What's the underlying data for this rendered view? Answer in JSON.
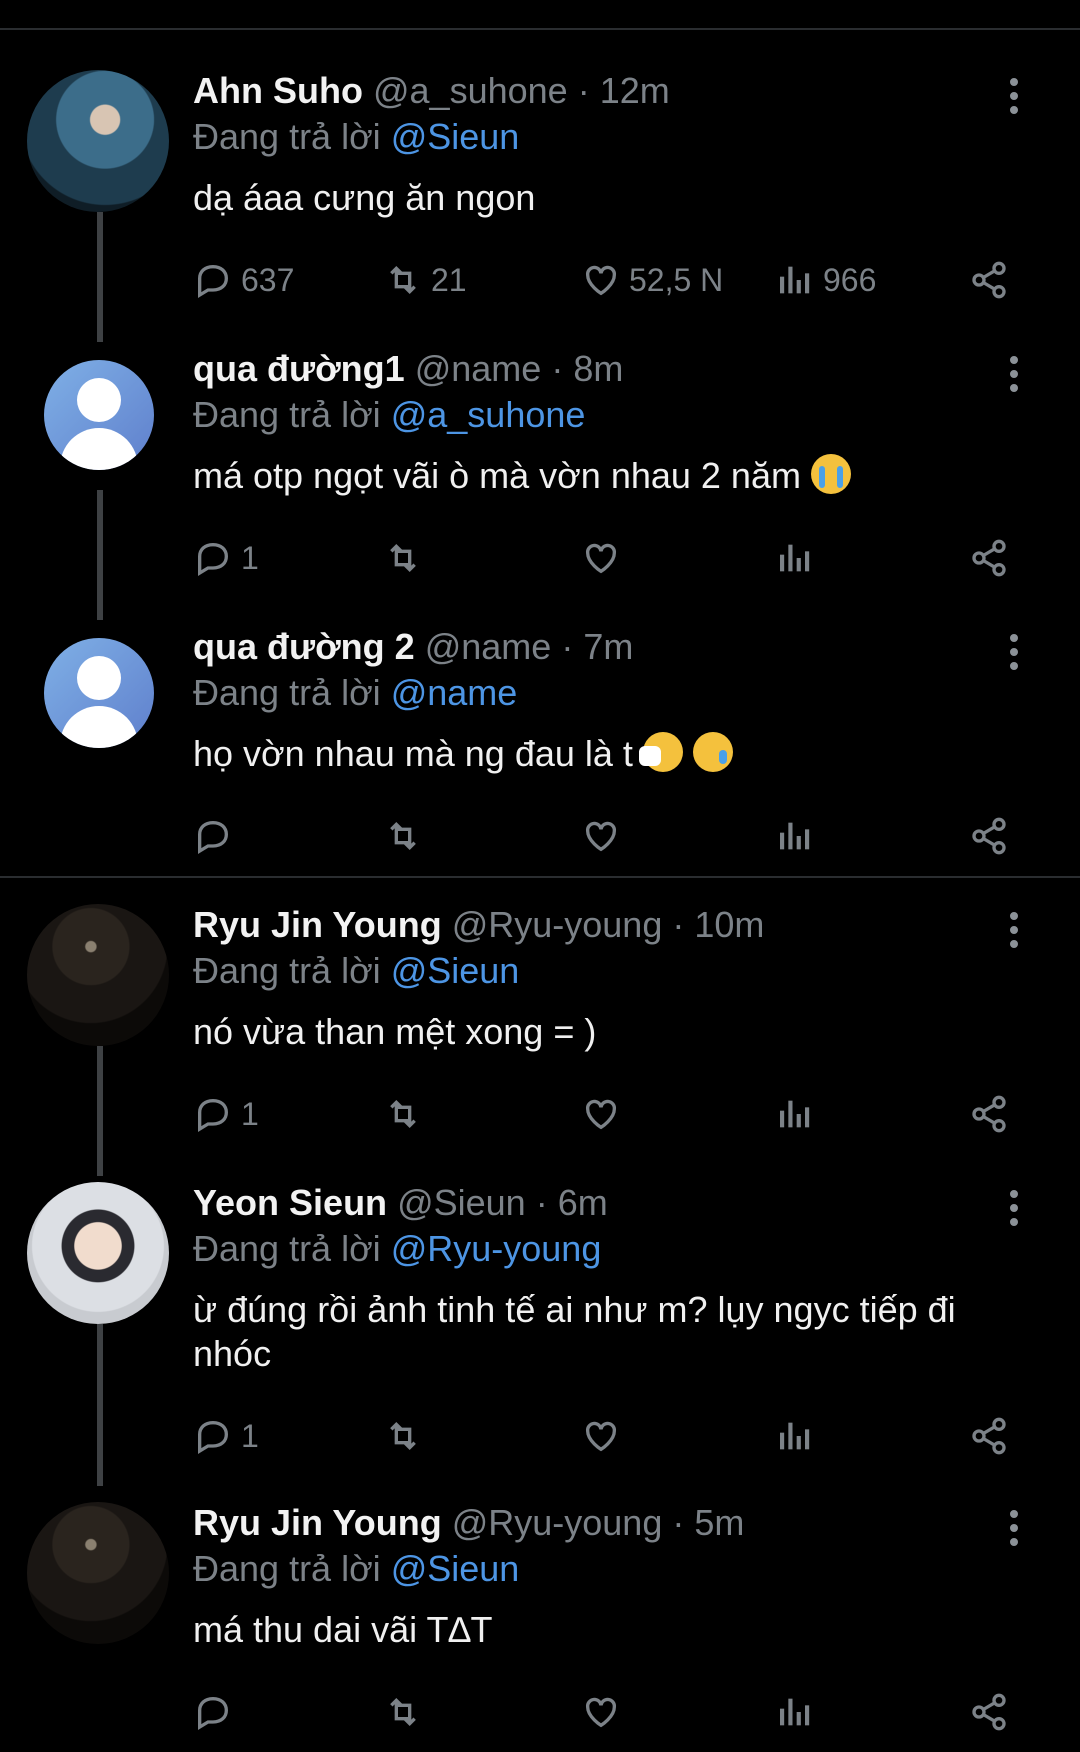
{
  "tweets": [
    {
      "name": "Ahn Suho",
      "handle": "@a_suhone",
      "sep": "·",
      "time": "12m",
      "reply_prefix": "Đang trả lời",
      "reply_to": "@Sieun",
      "text": "dạ áaa cưng ăn ngon",
      "emojis": [],
      "replies": "637",
      "retweets": "21",
      "likes": "52,5 N",
      "views": "966",
      "avatar": "photo1"
    },
    {
      "name": "qua đường1",
      "handle": "@name",
      "sep": "·",
      "time": "8m",
      "reply_prefix": "Đang trả lời",
      "reply_to": "@a_suhone",
      "text": "má otp ngọt vãi ò mà vờn nhau 2 năm",
      "emojis": [
        "loudly-crying-face"
      ],
      "replies": "1",
      "retweets": "",
      "likes": "",
      "views": "",
      "avatar": "default"
    },
    {
      "name": "qua đường 2",
      "handle": "@name",
      "sep": "·",
      "time": "7m",
      "reply_prefix": "Đang trả lời",
      "reply_to": "@name",
      "text": "họ vờn nhau mà ng đau là t",
      "emojis": [
        "sneezing-face",
        "crying-face"
      ],
      "replies": "",
      "retweets": "",
      "likes": "",
      "views": "",
      "avatar": "default"
    },
    {
      "name": "Ryu Jin Young",
      "handle": "@Ryu-young",
      "sep": "·",
      "time": "10m",
      "reply_prefix": "Đang trả lời",
      "reply_to": "@Sieun",
      "text": "nó vừa than mệt xong = )",
      "emojis": [],
      "replies": "1",
      "retweets": "",
      "likes": "",
      "views": "",
      "avatar": "photo2"
    },
    {
      "name": "Yeon Sieun",
      "handle": "@Sieun",
      "sep": "·",
      "time": "6m",
      "reply_prefix": "Đang trả lời",
      "reply_to": "@Ryu-young",
      "text": "ừ đúng rồi ảnh tinh tế ai như m? lụy ngyc tiếp đi nhóc",
      "emojis": [],
      "replies": "1",
      "retweets": "",
      "likes": "",
      "views": "",
      "avatar": "photo3"
    },
    {
      "name": "Ryu Jin Young",
      "handle": "@Ryu-young",
      "sep": "·",
      "time": "5m",
      "reply_prefix": "Đang trả lời",
      "reply_to": "@Sieun",
      "text": "má thu dai vãi T∆T",
      "emojis": [],
      "replies": "",
      "retweets": "",
      "likes": "",
      "views": "",
      "avatar": "photo2"
    }
  ],
  "colors": {
    "background": "#000000",
    "mention": "#4d95e4",
    "muted": "#7c8288",
    "divider": "#2a2d30"
  },
  "icons": [
    "more-icon",
    "reply-icon",
    "retweet-icon",
    "like-icon",
    "views-icon",
    "share-icon"
  ]
}
